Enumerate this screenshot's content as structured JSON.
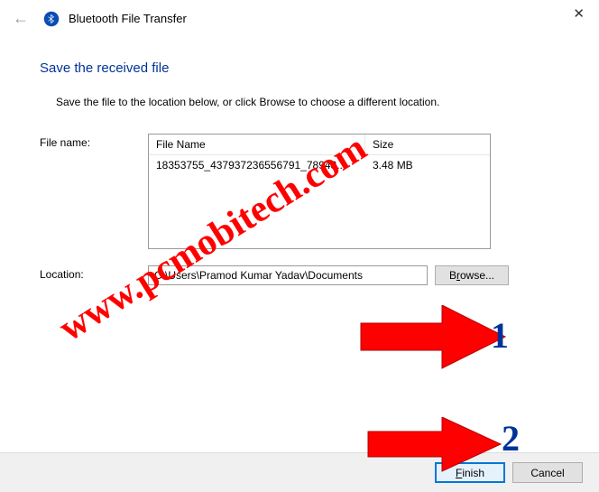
{
  "header": {
    "title": "Bluetooth File Transfer"
  },
  "subtitle": "Save the received file",
  "instruction": "Save the file to the location below, or click Browse to choose a different location.",
  "filename_label": "File name:",
  "table": {
    "col_filename": "File Name",
    "col_size": "Size",
    "rows": [
      {
        "name": "18353755_437937236556791_78943...",
        "size": "3.48 MB"
      }
    ]
  },
  "location_label": "Location:",
  "location_value": "C:\\Users\\Pramod Kumar Yadav\\Documents",
  "browse_label": "Browse...",
  "finish_label": "Finish",
  "cancel_label": "Cancel",
  "annotations": {
    "watermark": "www.pcmobitech.com",
    "n1": "1",
    "n2": "2"
  }
}
